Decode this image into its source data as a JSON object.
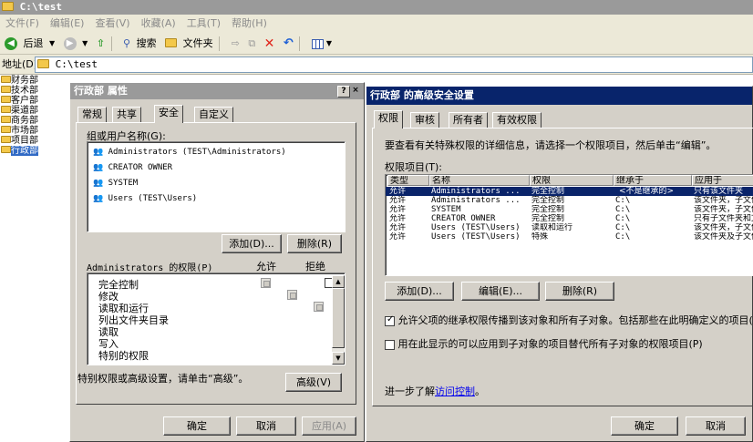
{
  "window": {
    "title": "C:\\test"
  },
  "menu": [
    "文件(F)",
    "编辑(E)",
    "查看(V)",
    "收藏(A)",
    "工具(T)",
    "帮助(H)"
  ],
  "toolbar": {
    "back": "后退",
    "search": "搜索",
    "folders": "文件夹"
  },
  "address": {
    "label": "地址(D)",
    "value": "C:\\test"
  },
  "tree": [
    "财务部",
    "技术部",
    "客户部",
    "渠道部",
    "商务部",
    "市场部",
    "项目部",
    "行政部"
  ],
  "props": {
    "title": "行政部 属性",
    "help_btn": "?",
    "close_btn": "×",
    "tabs": [
      "常规",
      "共享",
      "安全",
      "自定义"
    ],
    "users_label": "组或用户名称(G):",
    "users": [
      "Administrators (TEST\\Administrators)",
      "CREATOR OWNER",
      "SYSTEM",
      "Users (TEST\\Users)"
    ],
    "add_btn": "添加(D)...",
    "remove_btn": "删除(R)",
    "perm_label": "Administrators 的权限(P)",
    "allow_col": "允许",
    "deny_col": "拒绝",
    "permissions": [
      {
        "name": "完全控制"
      },
      {
        "name": "修改"
      },
      {
        "name": "读取和运行"
      },
      {
        "name": "列出文件夹目录"
      },
      {
        "name": "读取"
      },
      {
        "name": "写入"
      },
      {
        "name": "特别的权限"
      }
    ],
    "advanced_text": "特别权限或高级设置，请单击“高级”。",
    "advanced_btn": "高级(V)",
    "ok": "确定",
    "cancel": "取消",
    "apply": "应用(A)"
  },
  "adv": {
    "title": "行政部 的高级安全设置",
    "tabs": [
      "权限",
      "审核",
      "所有者",
      "有效权限"
    ],
    "info": "要查看有关特殊权限的详细信息，请选择一个权限项目，然后单击“编辑”。",
    "entries_label": "权限项目(T):",
    "columns": [
      "类型",
      "名称",
      "权限",
      "继承于",
      "应用于"
    ],
    "rows": [
      [
        "允许",
        "Administrators ...",
        "完全控制",
        "<不是继承的>",
        "只有该文件夹"
      ],
      [
        "允许",
        "Administrators ...",
        "完全控制",
        "C:\\",
        "该文件夹，子文件夹"
      ],
      [
        "允许",
        "SYSTEM",
        "完全控制",
        "C:\\",
        "该文件夹，子文件夹"
      ],
      [
        "允许",
        "CREATOR OWNER",
        "完全控制",
        "C:\\",
        "只有子文件夹和文件"
      ],
      [
        "允许",
        "Users (TEST\\Users)",
        "读取和运行",
        "C:\\",
        "该文件夹，子文件夹"
      ],
      [
        "允许",
        "Users (TEST\\Users)",
        "特殊",
        "C:\\",
        "该文件夹及子文件夹"
      ]
    ],
    "add_btn": "添加(D)...",
    "edit_btn": "编辑(E)...",
    "remove_btn": "删除(R)",
    "inherit_text": "允许父项的继承权限传播到该对象和所有子对象。包括那些在此明确定义的项目(A)",
    "replace_text": "用在此显示的可以应用到子对象的项目替代所有子对象的权限项目(P)",
    "learn_prefix": "进一步了解",
    "learn_link": "访问控制",
    "learn_suffix": "。",
    "ok": "确定",
    "cancel": "取消"
  }
}
